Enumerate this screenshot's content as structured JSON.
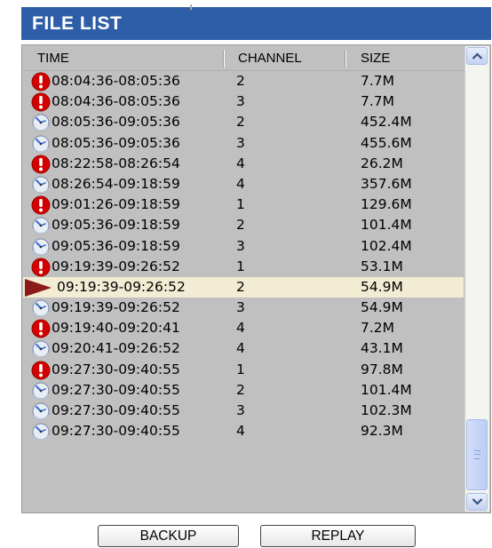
{
  "title": "FILE LIST",
  "columns": {
    "time": "TIME",
    "channel": "CHANNEL",
    "size": "SIZE"
  },
  "rows": [
    {
      "icon": "alarm-icon",
      "time": "08:04:36-08:05:36",
      "channel": "2",
      "size": "7.7M"
    },
    {
      "icon": "alarm-icon",
      "time": "08:04:36-08:05:36",
      "channel": "3",
      "size": "7.7M"
    },
    {
      "icon": "clock-icon",
      "time": "08:05:36-09:05:36",
      "channel": "2",
      "size": "452.4M"
    },
    {
      "icon": "clock-icon",
      "time": "08:05:36-09:05:36",
      "channel": "3",
      "size": "455.6M"
    },
    {
      "icon": "alarm-icon",
      "time": "08:22:58-08:26:54",
      "channel": "4",
      "size": "26.2M"
    },
    {
      "icon": "clock-icon",
      "time": "08:26:54-09:18:59",
      "channel": "4",
      "size": "357.6M"
    },
    {
      "icon": "alarm-icon",
      "time": "09:01:26-09:18:59",
      "channel": "1",
      "size": "129.6M"
    },
    {
      "icon": "clock-icon",
      "time": "09:05:36-09:18:59",
      "channel": "2",
      "size": "101.4M"
    },
    {
      "icon": "clock-icon",
      "time": "09:05:36-09:18:59",
      "channel": "3",
      "size": "102.4M"
    },
    {
      "icon": "alarm-icon",
      "time": "09:19:39-09:26:52",
      "channel": "1",
      "size": "53.1M"
    },
    {
      "icon": "play-marker-icon",
      "time": "09:19:39-09:26:52",
      "channel": "2",
      "size": "54.9M",
      "selected": true
    },
    {
      "icon": "clock-icon",
      "time": "09:19:39-09:26:52",
      "channel": "3",
      "size": "54.9M"
    },
    {
      "icon": "alarm-icon",
      "time": "09:19:40-09:20:41",
      "channel": "4",
      "size": "7.2M"
    },
    {
      "icon": "clock-icon",
      "time": "09:20:41-09:26:52",
      "channel": "4",
      "size": "43.1M"
    },
    {
      "icon": "alarm-icon",
      "time": "09:27:30-09:40:55",
      "channel": "1",
      "size": "97.8M"
    },
    {
      "icon": "clock-icon",
      "time": "09:27:30-09:40:55",
      "channel": "2",
      "size": "101.4M"
    },
    {
      "icon": "clock-icon",
      "time": "09:27:30-09:40:55",
      "channel": "3",
      "size": "102.3M"
    },
    {
      "icon": "clock-icon",
      "time": "09:27:30-09:40:55",
      "channel": "4",
      "size": "92.3M"
    }
  ],
  "buttons": {
    "backup": "BACKUP",
    "replay": "REPLAY"
  },
  "colors": {
    "title_bar": "#2e5ea8",
    "list_bg": "#c0c0c0",
    "selected_row": "#f1ecd3",
    "alarm": "#d40000",
    "marker": "#8b1a1a"
  }
}
